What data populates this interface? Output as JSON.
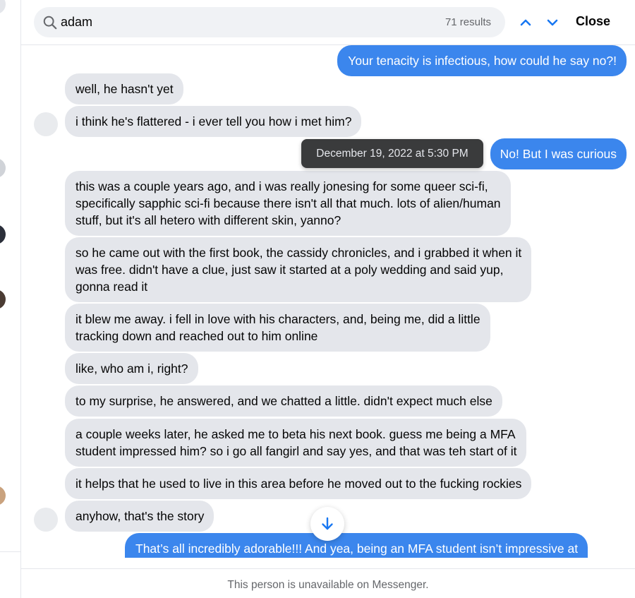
{
  "search": {
    "query": "adam",
    "result_count": "71 results",
    "close_label": "Close"
  },
  "messages": [
    {
      "side": "out",
      "text": "Your tenacity is infectious, how could he say no?!"
    },
    {
      "side": "in",
      "text": "well, he hasn't yet"
    },
    {
      "side": "in",
      "text": "i think he's flattered - i ever tell you how i met him?"
    },
    {
      "side": "out",
      "text": "No! But I was curious"
    },
    {
      "side": "in",
      "text": "this was a couple years ago, and i was really jonesing for some queer sci-fi,\nspecifically sapphic sci-fi because there isn't all that much. lots of alien/human\nstuff, but it's all hetero with different skin, yanno?"
    },
    {
      "side": "in",
      "text": "so he came out with the first book, the cassidy chronicles, and i grabbed it when it\nwas free. didn't have a clue, just saw it started at a poly wedding and said yup,\ngonna read it"
    },
    {
      "side": "in",
      "text": "it blew me away. i fell in love with his characters, and, being me, did a little\ntracking down and reached out to him online"
    },
    {
      "side": "in",
      "text": "like, who am i, right?"
    },
    {
      "side": "in",
      "text": "to my surprise, he answered, and we chatted a little. didn't expect much else"
    },
    {
      "side": "in",
      "text": "a couple weeks later, he asked me to beta his next book. guess me being a MFA\nstudent impressed him? so i go all fangirl and say yes, and that was teh start of it"
    },
    {
      "side": "in",
      "text": "it helps that he used to live in this area before he moved out to the fucking rockies"
    },
    {
      "side": "in",
      "text": "anyhow, that's the story"
    },
    {
      "side": "out",
      "text": "That’s all incredibly adorable!!! And yea, being an MFA student isn’t impressive at"
    }
  ],
  "tooltip": "December 19, 2022 at 5:30 PM",
  "footer": "This person is unavailable on Messenger.",
  "colors": {
    "outgoing_bubble": "#3b86ed",
    "incoming_bubble": "#e4e6eb",
    "accent": "#1877f2"
  },
  "icons": {
    "search": "search-icon",
    "prev": "chevron-up-icon",
    "next": "chevron-down-icon",
    "scroll": "arrow-down-icon"
  }
}
